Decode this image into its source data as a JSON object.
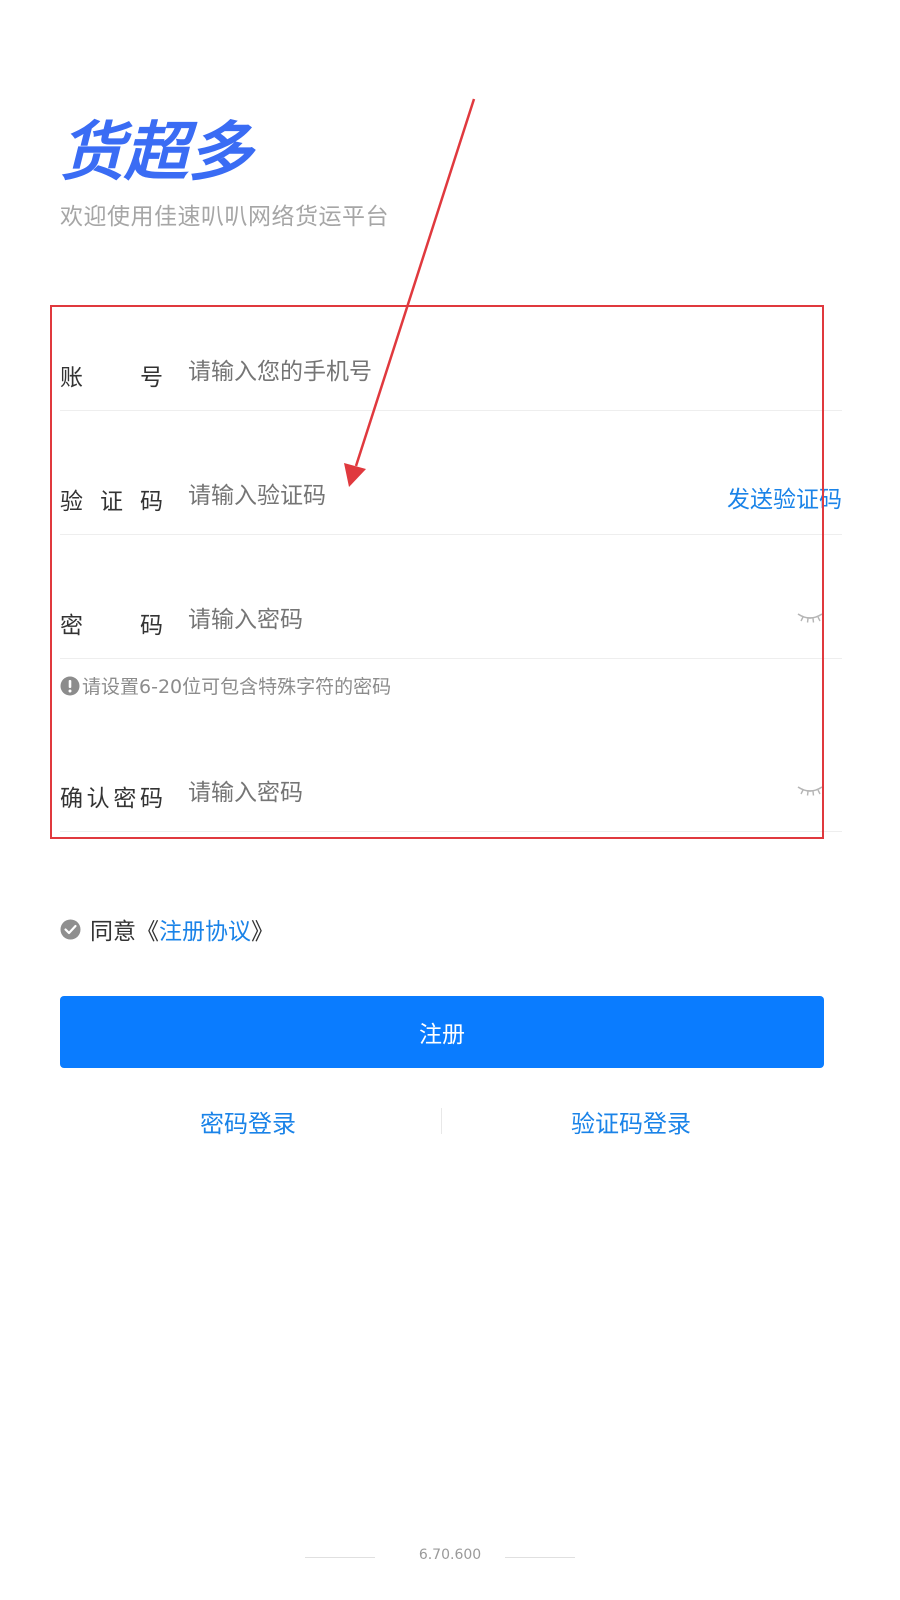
{
  "brand": {
    "logo_text": "货超多",
    "logo_color": "#3a6cf4",
    "subtitle": "欢迎使用佳速叭叭网络货运平台"
  },
  "form": {
    "account": {
      "label": "账　　号",
      "placeholder": "请输入您的手机号"
    },
    "code": {
      "label": "验 证 码",
      "placeholder": "请输入验证码",
      "send_label": "发送验证码"
    },
    "password": {
      "label": "密　　码",
      "placeholder": "请输入密码",
      "toggle_icon": "eye-closed-icon"
    },
    "password_hint": "请设置6-20位可包含特殊字符的密码",
    "confirm": {
      "label": "确认密码",
      "placeholder": "请输入密码",
      "toggle_icon": "eye-closed-icon"
    }
  },
  "agreement": {
    "prefix": "同意《",
    "link": "注册协议",
    "suffix": "》",
    "checked": true
  },
  "register_button": "注册",
  "login_links": {
    "password_login": "密码登录",
    "code_login": "验证码登录"
  },
  "version": "6.70.600",
  "colors": {
    "primary": "#0a7cff",
    "link": "#1a83e8",
    "annotation": "#e0393e"
  }
}
